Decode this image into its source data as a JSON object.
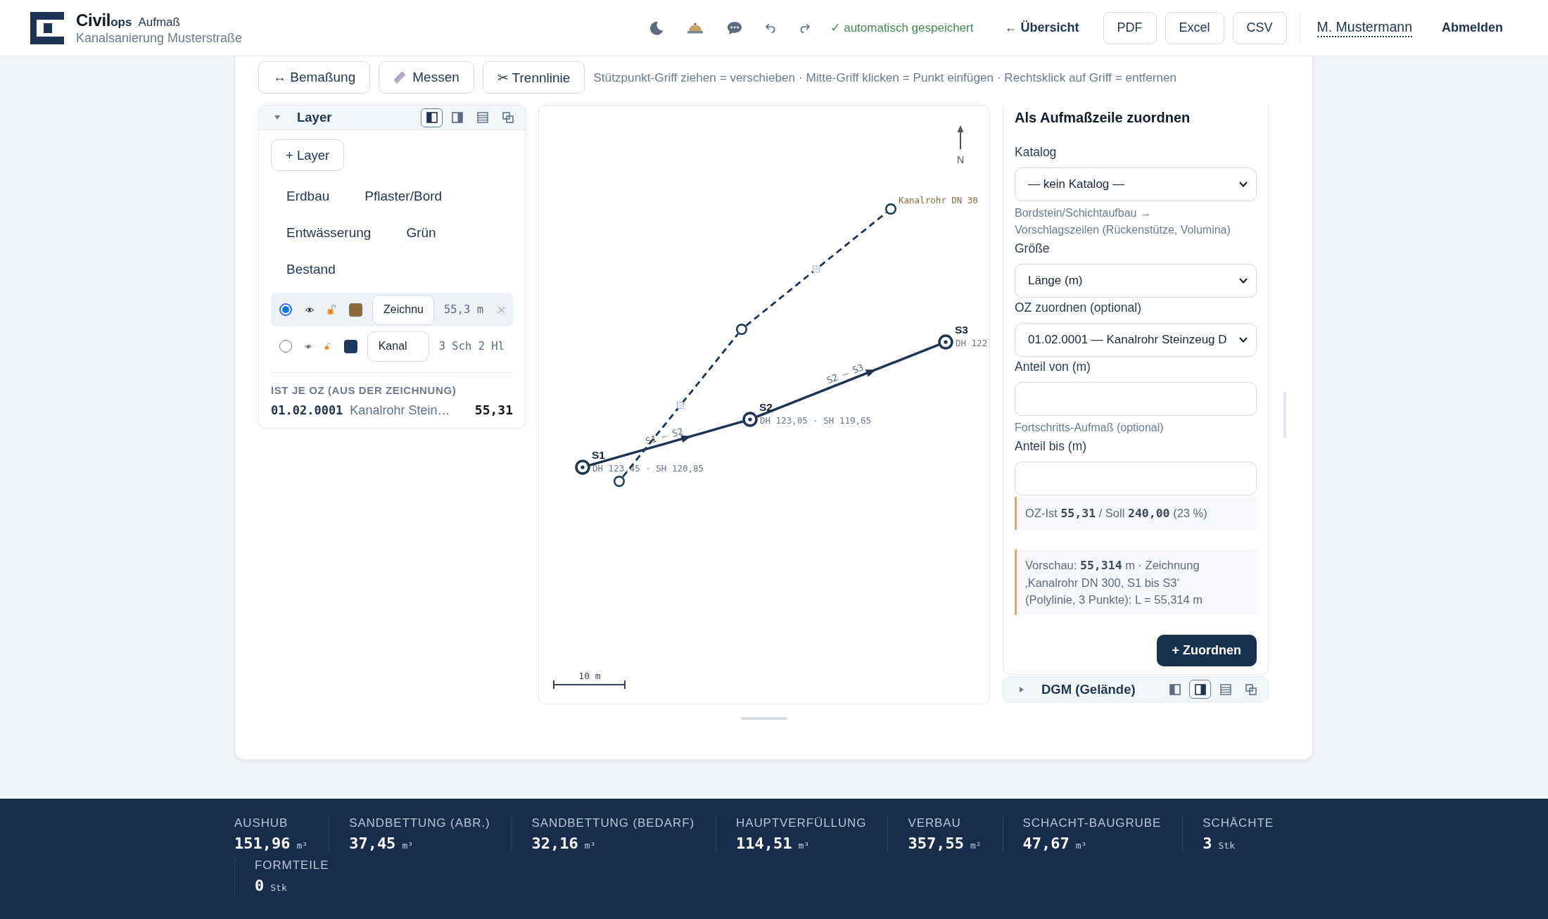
{
  "header": {
    "brand": {
      "name": "Civil",
      "suffix": "ops",
      "module": "Aufmaß"
    },
    "project": "Kanalsanierung Musterstraße",
    "save_status": "✓ automatisch gespeichert",
    "back_link": "← Übersicht",
    "exports": [
      "PDF",
      "Excel",
      "CSV"
    ],
    "user": "M. Mustermann",
    "logout": "Abmelden"
  },
  "toolbar": {
    "tools": [
      {
        "kind": "text",
        "label": "↔ Bemaßung"
      },
      {
        "kind": "ruler",
        "label": "Messen"
      },
      {
        "kind": "text",
        "label": "✂ Trennlinie"
      }
    ],
    "hint": "Stützpunkt-Griff ziehen = verschieben · Mitte-Griff klicken = Punkt einfügen · Rechtsklick auf Griff = entfernen"
  },
  "layer_panel": {
    "title": "Layer",
    "expanded": true,
    "view_modes": [
      {
        "kind": "dock-left",
        "selected": true
      },
      {
        "kind": "dock-right",
        "selected": false
      },
      {
        "kind": "list",
        "selected": false
      },
      {
        "kind": "detach",
        "selected": false
      }
    ],
    "add_button": "+ Layer",
    "groups": [
      "Erdbau",
      "Pflaster/Bord",
      "Entwässerung",
      "Grün",
      "Bestand"
    ],
    "layers": [
      {
        "selected": true,
        "visible": true,
        "locked": false,
        "color": "#8b6b3d",
        "name": "Zeichnu",
        "summary": "55,3 m"
      },
      {
        "selected": false,
        "visible": true,
        "locked": false,
        "color": "#1b3a5c",
        "name": "Kanal",
        "summary": "3 Sch 2 Hl"
      }
    ],
    "totals_title": "IST JE OZ (AUS DER ZEICHNUNG)",
    "totals": [
      {
        "code": "01.02.0001",
        "text": "Kanalrohr Stein…",
        "value": "55,31"
      }
    ]
  },
  "drawing": {
    "north_label": "N",
    "lines": [
      {
        "kind": "sewer",
        "segments": [
          "S1 – S2",
          "S2 – S3"
        ],
        "manholes": [
          {
            "name": "S1",
            "heights": "DH 123,45 · SH 120,85"
          },
          {
            "name": "S2",
            "heights": "DH 123,05 · SH 119,65"
          },
          {
            "name": "S3",
            "heights": "DH 122"
          }
        ]
      },
      {
        "kind": "sketch",
        "label": "Kanalrohr DN 30"
      }
    ],
    "scale_label": "10 m"
  },
  "assign_panel": {
    "title": "Als Aufmaßzeile zuordnen",
    "fields": [
      {
        "kind": "select",
        "label": "Katalog",
        "value": "— kein Katalog —",
        "hint": "Bordstein/Schichtaufbau → Vorschlagszeilen (Rückenstütze, Volumina)"
      },
      {
        "kind": "select",
        "label": "Größe",
        "value": "Länge (m)"
      },
      {
        "kind": "select",
        "label": "OZ zuordnen (optional)",
        "value": "01.02.0001 — Kanalrohr Steinzeug D"
      },
      {
        "kind": "input",
        "label": "Anteil von (m)",
        "hint": "Fortschritts-Aufmaß (optional)"
      },
      {
        "kind": "input",
        "label": "Anteil bis (m)"
      }
    ],
    "status": "OZ-Ist **55,31** / Soll **240,00** (23 %)",
    "preview": "Vorschau: **55,314** m · Zeichnung ‚Kanalrohr DN 300, S1 bis S3‘ (Polylinie, 3 Punkte): L = 55,314 m",
    "submit": "+ Zuordnen"
  },
  "dgm_panel": {
    "title": "DGM (Gelände)",
    "expanded": false,
    "view_modes": [
      {
        "kind": "dock-left",
        "selected": false
      },
      {
        "kind": "dock-right",
        "selected": true
      },
      {
        "kind": "list",
        "selected": false
      },
      {
        "kind": "detach",
        "selected": false
      }
    ]
  },
  "totals_bar": [
    {
      "label": "AUSHUB",
      "value": "151,96",
      "unit": "m³"
    },
    {
      "label": "SANDBETTUNG (ABR.)",
      "value": "37,45",
      "unit": "m³"
    },
    {
      "label": "SANDBETTUNG (BEDARF)",
      "value": "32,16",
      "unit": "m³"
    },
    {
      "label": "HAUPTVERFÜLLUNG",
      "value": "114,51",
      "unit": "m³"
    },
    {
      "label": "VERBAU",
      "value": "357,55",
      "unit": "m²"
    },
    {
      "label": "SCHACHT-BAUGRUBE",
      "value": "47,67",
      "unit": "m³"
    },
    {
      "label": "SCHÄCHTE",
      "value": "3",
      "unit": "Stk"
    },
    {
      "label": "FORMTEILE",
      "value": "0",
      "unit": "Stk"
    }
  ]
}
